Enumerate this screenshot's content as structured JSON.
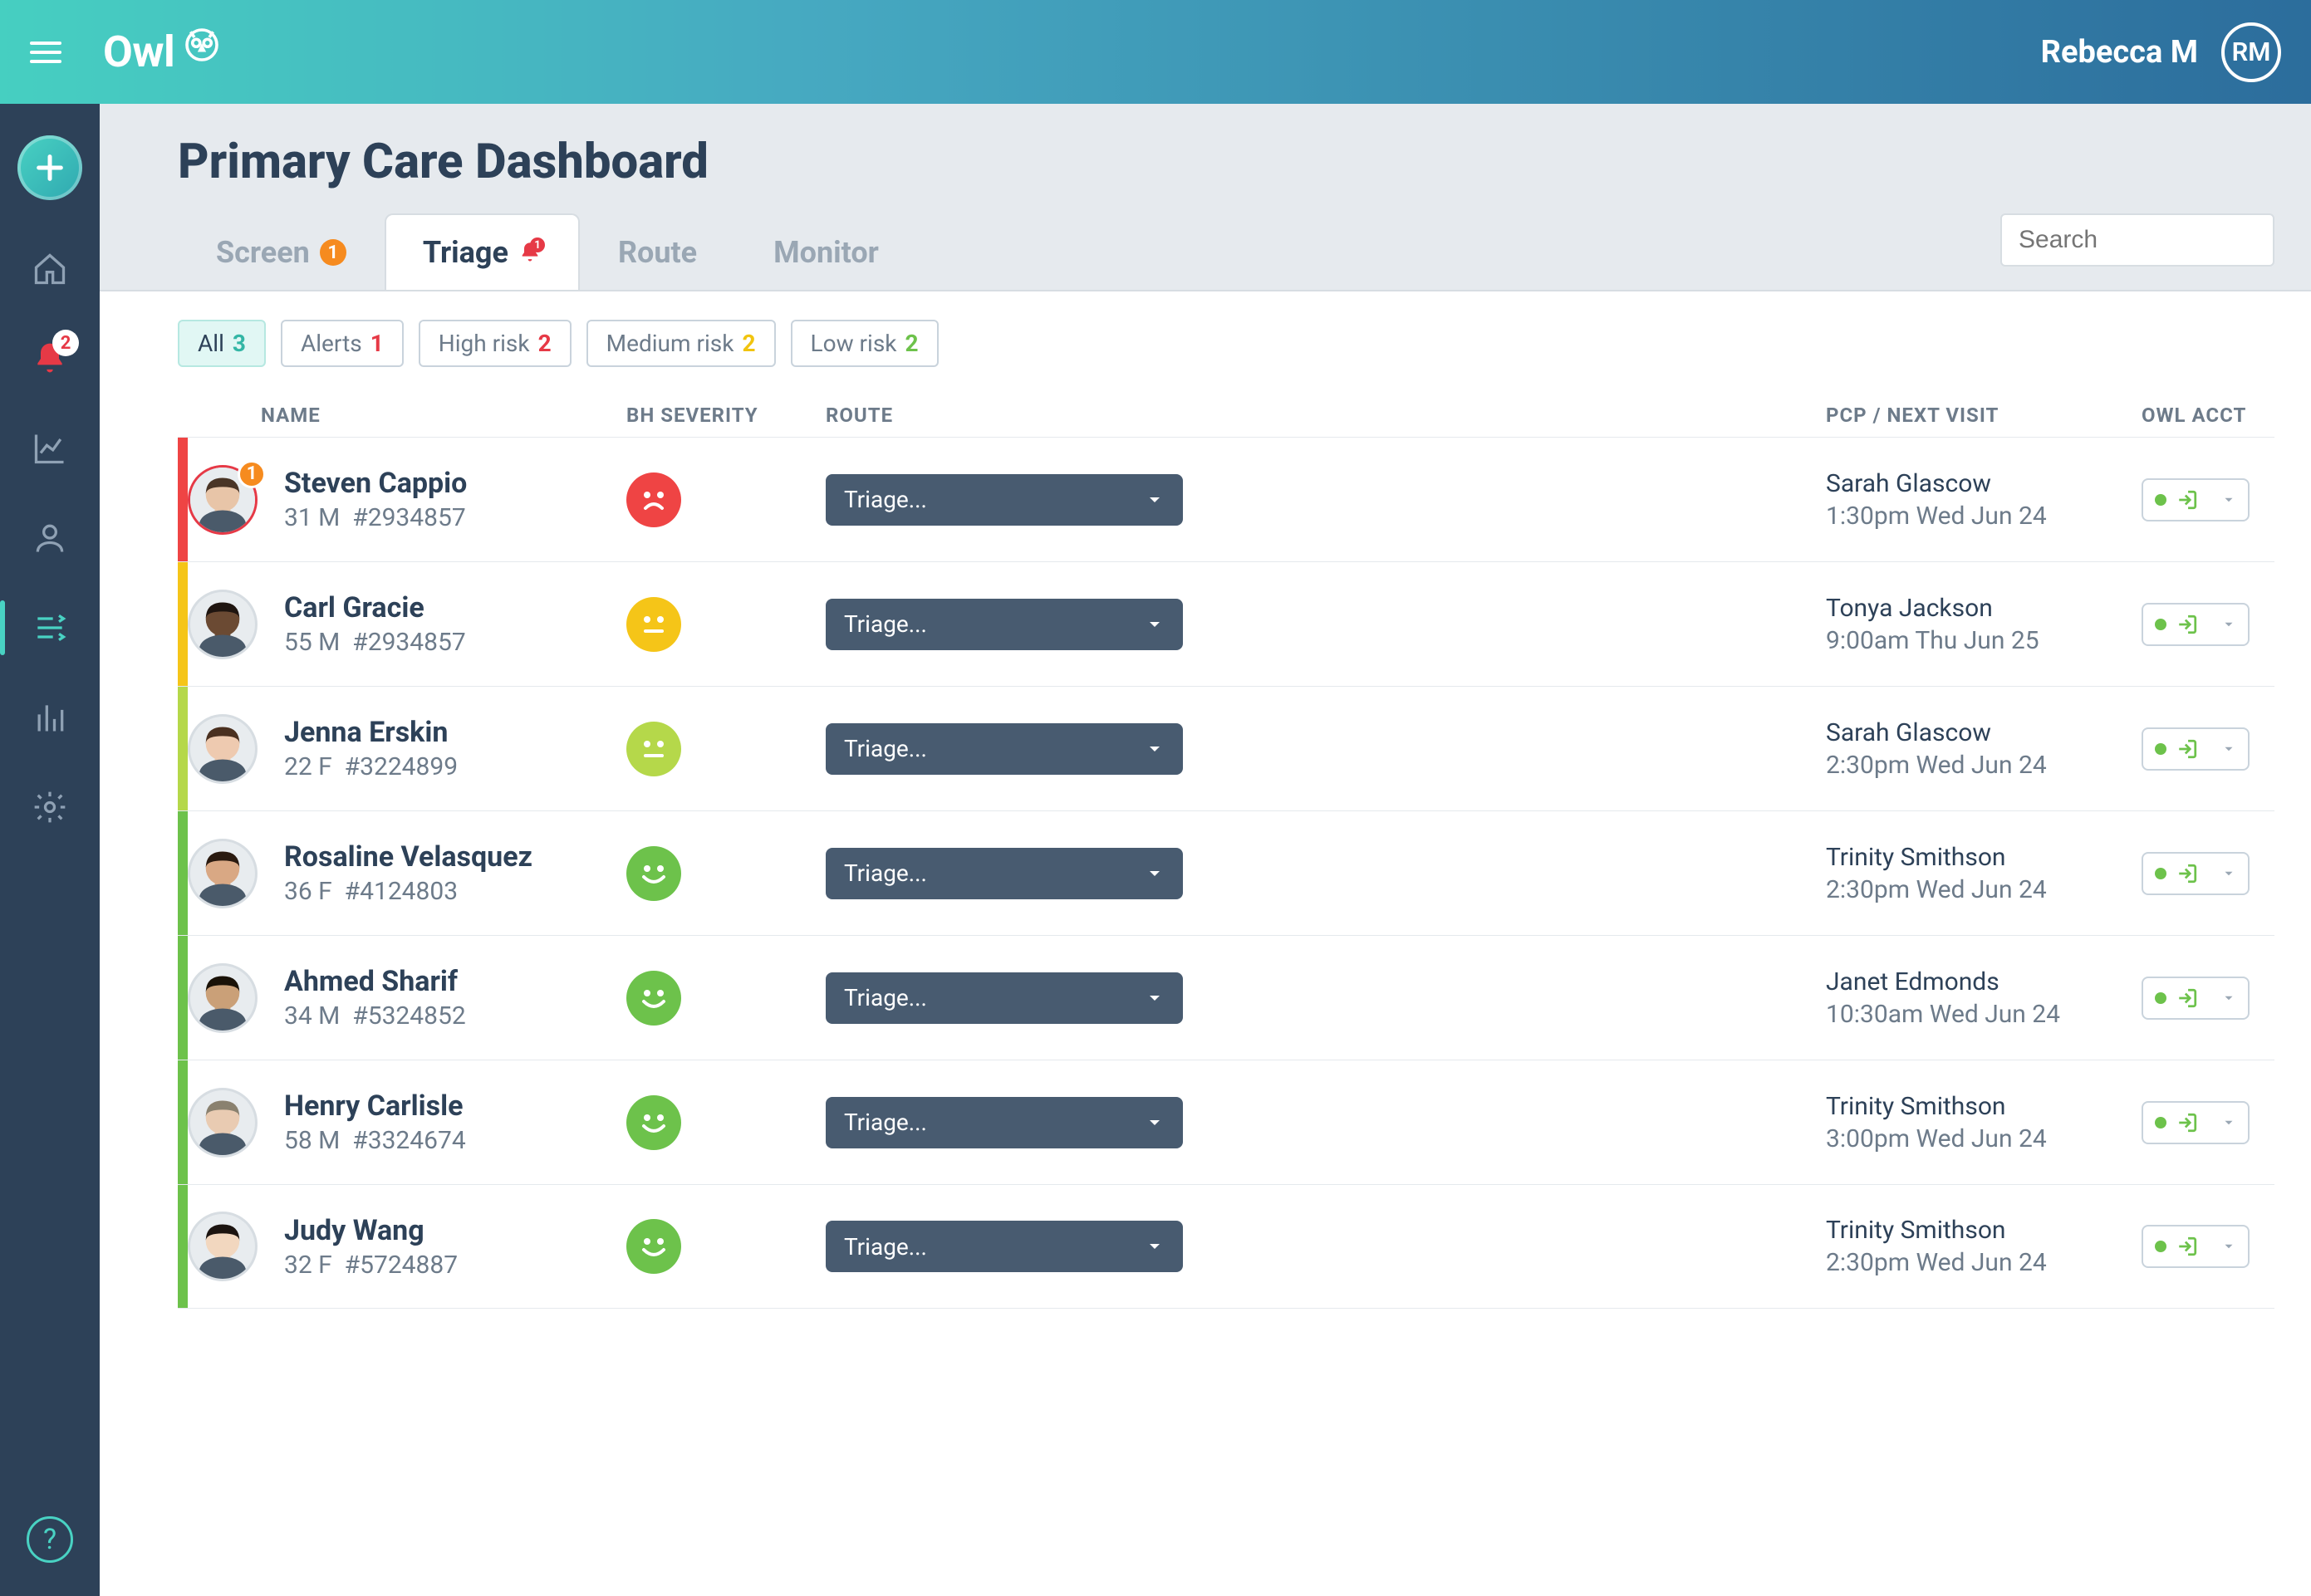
{
  "brand": "Owl",
  "user": {
    "name": "Rebecca M",
    "initials": "RM"
  },
  "sidenav": {
    "alerts_badge": "2"
  },
  "page_title": "Primary Care Dashboard",
  "tabs": [
    {
      "label": "Screen",
      "badge": "1",
      "active": false
    },
    {
      "label": "Triage",
      "bell": "1",
      "active": true
    },
    {
      "label": "Route",
      "active": false
    },
    {
      "label": "Monitor",
      "active": false
    }
  ],
  "search_placeholder": "Search",
  "filters": [
    {
      "label": "All",
      "count": "3",
      "count_class": "cnt-teal",
      "active": true
    },
    {
      "label": "Alerts",
      "count": "1",
      "count_class": "cnt-red"
    },
    {
      "label": "High risk",
      "count": "2",
      "count_class": "cnt-red"
    },
    {
      "label": "Medium risk",
      "count": "2",
      "count_class": "cnt-yellow"
    },
    {
      "label": "Low risk",
      "count": "2",
      "count_class": "cnt-green"
    }
  ],
  "columns": {
    "name": "NAME",
    "severity": "BH SEVERITY",
    "route": "ROUTE",
    "pcp": "PCP / NEXT VISIT",
    "acct": "OWL ACCT"
  },
  "route_label": "Triage...",
  "patients": [
    {
      "name": "Steven Cappio",
      "meta": "31 M  #2934857",
      "severity": "sev-red",
      "stripe": "#ef4444",
      "pcp": "Sarah Glascow",
      "visit": "1:30pm Wed Jun 24",
      "alert_badge": "1",
      "skin": "#e8c5a8",
      "hair": "#4a3526"
    },
    {
      "name": "Carl Gracie",
      "meta": "55 M  #2934857",
      "severity": "sev-yellow",
      "stripe": "#f5c518",
      "pcp": "Tonya Jackson",
      "visit": "9:00am Thu Jun 25",
      "skin": "#6b4a33",
      "hair": "#1f1510"
    },
    {
      "name": "Jenna Erskin",
      "meta": "22 F  #3224899",
      "severity": "sev-yg",
      "stripe": "#b5d84a",
      "pcp": "Sarah Glascow",
      "visit": "2:30pm Wed Jun 24",
      "skin": "#eecab0",
      "hair": "#4a3020"
    },
    {
      "name": "Rosaline Velasquez",
      "meta": "36 F  #4124803",
      "severity": "sev-green",
      "stripe": "#6dc24b",
      "pcp": "Trinity Smithson",
      "visit": "2:30pm Wed Jun 24",
      "skin": "#d9a884",
      "hair": "#2a1a10"
    },
    {
      "name": "Ahmed Sharif",
      "meta": "34 M  #5324852",
      "severity": "sev-green",
      "stripe": "#6dc24b",
      "pcp": "Janet Edmonds",
      "visit": "10:30am Wed Jun 24",
      "skin": "#caa078",
      "hair": "#1a1208"
    },
    {
      "name": "Henry Carlisle",
      "meta": "58 M  #3324674",
      "severity": "sev-green",
      "stripe": "#6dc24b",
      "pcp": "Trinity Smithson",
      "visit": "3:00pm Wed Jun 24",
      "skin": "#e9cbb2",
      "hair": "#8a816f"
    },
    {
      "name": "Judy Wang",
      "meta": "32 F  #5724887",
      "severity": "sev-green",
      "stripe": "#6dc24b",
      "pcp": "Trinity Smithson",
      "visit": "2:30pm Wed Jun 24",
      "skin": "#f2d7bf",
      "hair": "#1c1410"
    }
  ]
}
